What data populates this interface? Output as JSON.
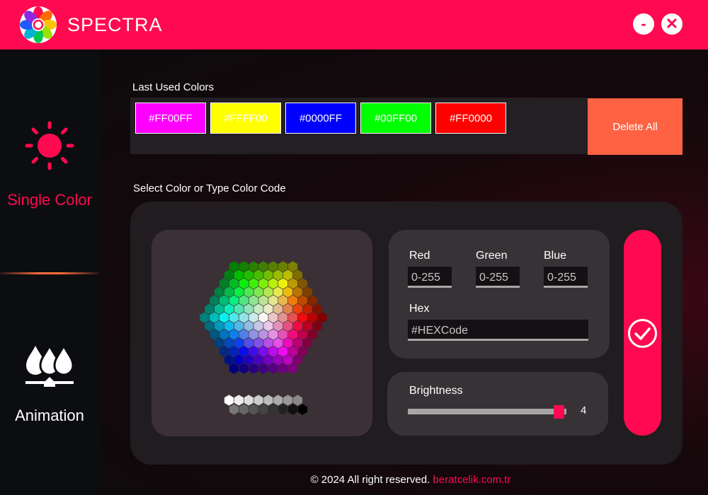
{
  "app": {
    "title": "SPECTRA",
    "minimize_label": "-",
    "close_label": "✕"
  },
  "sidebar": {
    "items": [
      {
        "label": "Single Color",
        "icon": "sun-icon",
        "active": true,
        "color": "#ff0a50"
      },
      {
        "label": "Animation",
        "icon": "droplets-icon",
        "active": false,
        "color": "#ffffff"
      }
    ]
  },
  "last_used": {
    "title": "Last Used Colors",
    "colors": [
      {
        "label": "#FF00FF",
        "hex": "#FF00FF"
      },
      {
        "label": "#FFFF00",
        "hex": "#FFFF00"
      },
      {
        "label": "#0000FF",
        "hex": "#0000FF"
      },
      {
        "label": "#00FF00",
        "hex": "#00FF00"
      },
      {
        "label": "#FF0000",
        "hex": "#FF0000"
      }
    ],
    "delete_label": "Delete All"
  },
  "picker": {
    "title": "Select Color or Type Color Code",
    "red_label": "Red",
    "green_label": "Green",
    "blue_label": "Blue",
    "red_placeholder": "0-255",
    "green_placeholder": "0-255",
    "blue_placeholder": "0-255",
    "hex_label": "Hex",
    "hex_placeholder": "#HEXCode",
    "brightness_label": "Brightness",
    "brightness_value": "4",
    "brightness_fraction": 0.95
  },
  "footer": {
    "text": "© 2024 All right reserved.",
    "link": "beratcelik.com.tr"
  },
  "colors": {
    "accent": "#ff0a50",
    "delete": "#ff6243"
  }
}
